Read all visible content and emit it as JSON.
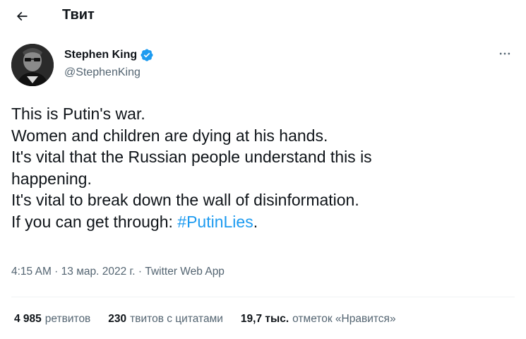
{
  "header": {
    "title": "Твит",
    "back_icon": "arrow-left-icon"
  },
  "author": {
    "name": "Stephen King",
    "handle": "@StephenKing",
    "verified_icon": "verified-badge-icon",
    "verified_color": "#1d9bf0",
    "more_icon": "more-horizontal-icon"
  },
  "tweet": {
    "lines": [
      "This is Putin's war.",
      "Women and children are dying at his hands.",
      "It's vital that the Russian people understand this is",
      "happening.",
      "It's vital to break down the wall of disinformation."
    ],
    "last_line_prefix": "If you can get through: ",
    "hashtag": "#PutinLies",
    "last_line_suffix": "."
  },
  "meta": {
    "time": "4:15 AM",
    "separator": " · ",
    "date": "13 мар. 2022 г.",
    "source": "Twitter Web App"
  },
  "stats": {
    "retweets_count": "4 985",
    "retweets_label": "ретвитов",
    "quotes_count": "230",
    "quotes_label": "твитов с цитатами",
    "likes_count": "19,7 тыс.",
    "likes_label": "отметок «Нравится»"
  },
  "colors": {
    "link": "#1d9bf0",
    "text": "#0f1419",
    "secondary": "#536471"
  }
}
